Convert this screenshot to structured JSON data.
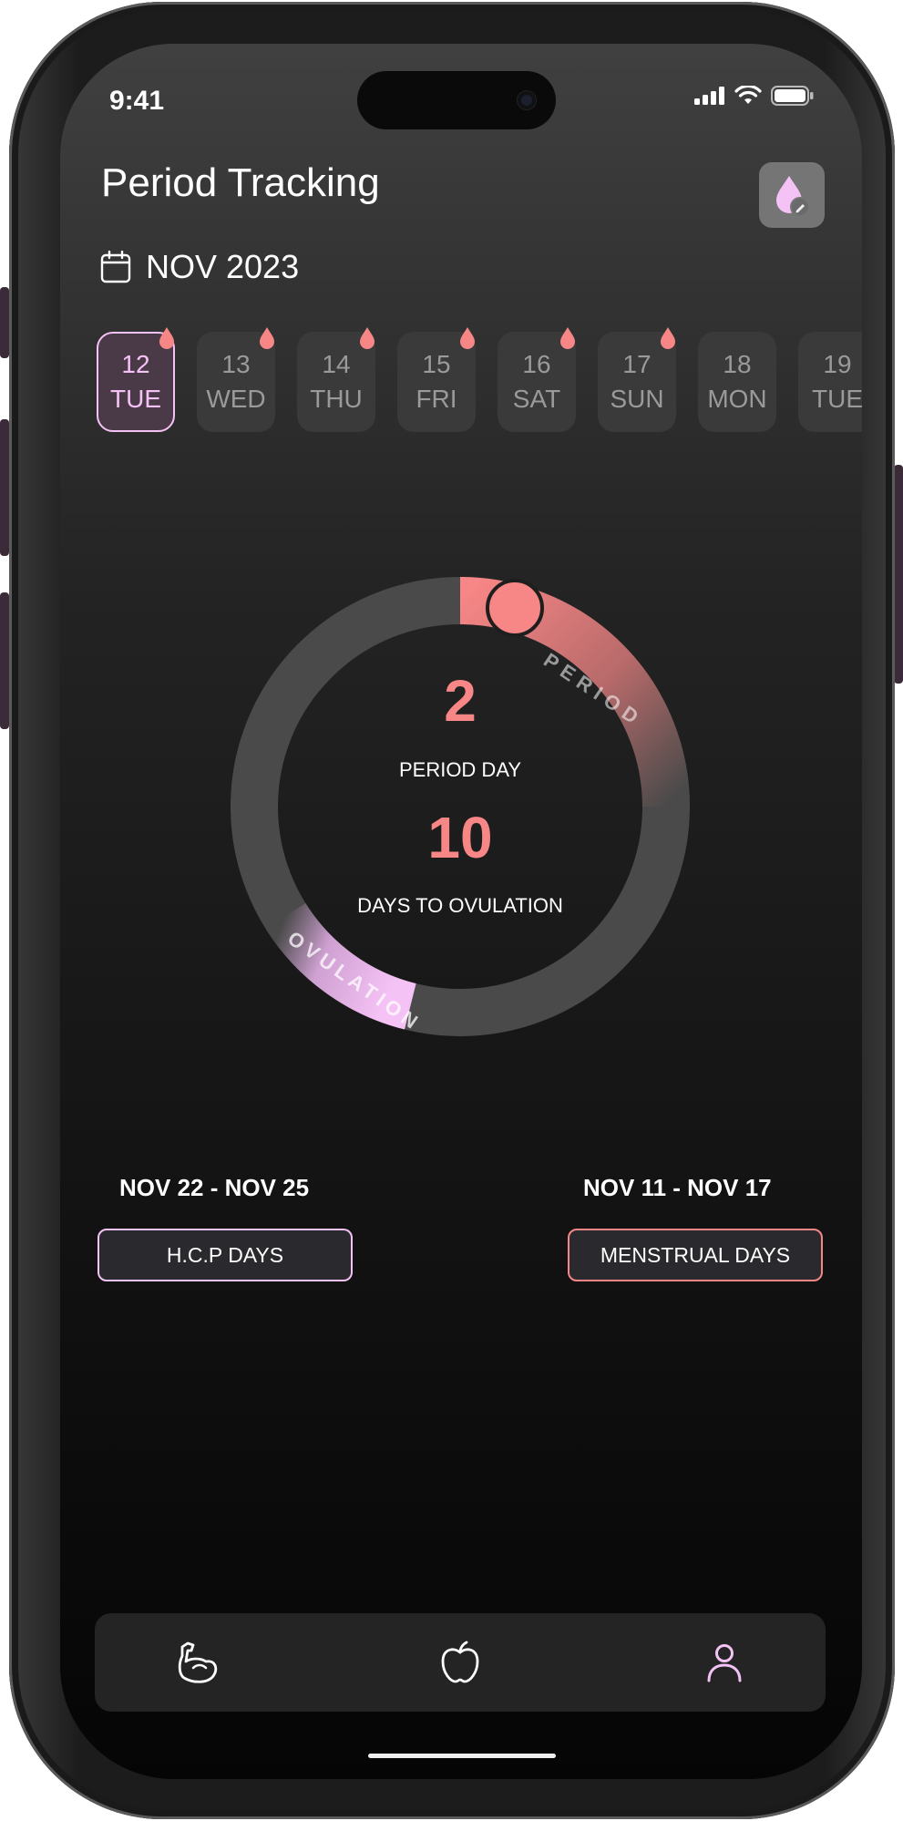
{
  "status_bar": {
    "time": "9:41"
  },
  "header": {
    "title": "Period Tracking",
    "action_icon": "drop-edit-icon"
  },
  "month_selector": {
    "icon": "calendar-icon",
    "label": "NOV 2023"
  },
  "dates": [
    {
      "day": "12",
      "weekday": "TUE",
      "selected": true,
      "period": true
    },
    {
      "day": "13",
      "weekday": "WED",
      "selected": false,
      "period": true
    },
    {
      "day": "14",
      "weekday": "THU",
      "selected": false,
      "period": true
    },
    {
      "day": "15",
      "weekday": "FRI",
      "selected": false,
      "period": true
    },
    {
      "day": "16",
      "weekday": "SAT",
      "selected": false,
      "period": true
    },
    {
      "day": "17",
      "weekday": "SUN",
      "selected": false,
      "period": true
    },
    {
      "day": "18",
      "weekday": "MON",
      "selected": false,
      "period": false
    },
    {
      "day": "19",
      "weekday": "TUE",
      "selected": false,
      "period": false
    }
  ],
  "cycle": {
    "period_label": "PERIOD",
    "ovulation_label": "OVULATION",
    "period_day": "2",
    "period_day_label": "PERIOD DAY",
    "days_to_ovulation": "10",
    "days_to_ovulation_label": "DAYS TO OVULATION"
  },
  "summary": {
    "hcp": {
      "range": "NOV 22 - NOV 25",
      "label": "H.C.P DAYS"
    },
    "menstrual": {
      "range": "NOV 11 - NOV 17",
      "label": "MENSTRUAL DAYS"
    }
  },
  "tab_bar": {
    "items": [
      "arm-muscle-icon",
      "apple-icon",
      "profile-icon"
    ],
    "active": "profile-icon"
  },
  "colors": {
    "period": "#f78686",
    "ovulation": "#f5c2f5",
    "accent_pink": "#f5c2f5"
  }
}
